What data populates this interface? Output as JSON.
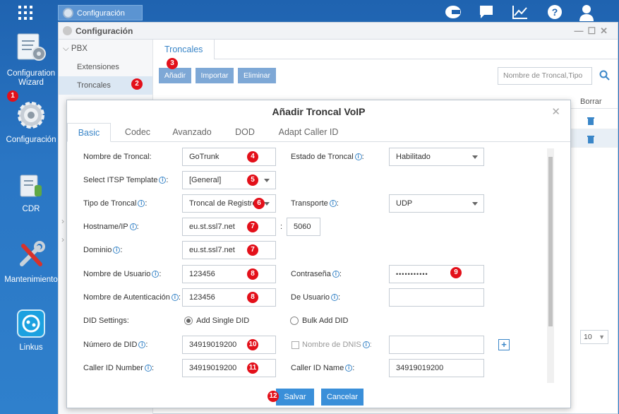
{
  "desktop": {
    "wizard_label": "Configuration Wizard",
    "config_label": "Configuración",
    "cdr_label": "CDR",
    "maint_label": "Mantenimiento",
    "linkus_label": "Linkus"
  },
  "taskbar": {
    "app_label": "Configuración"
  },
  "config_window": {
    "title": "Configuración",
    "nav": {
      "section": "PBX",
      "items": [
        "Extensiones",
        "Troncales"
      ]
    },
    "tab": "Troncales",
    "toolbar": {
      "add": "Añadir",
      "import": "Importar",
      "delete": "Eliminar"
    },
    "search_placeholder": "Nombre de Troncal,Tipo",
    "borrar_header": "Borrar",
    "page_size": "10"
  },
  "modal": {
    "title": "Añadir Troncal VoIP",
    "tabs": [
      "Basic",
      "Codec",
      "Avanzado",
      "DOD",
      "Adapt Caller ID"
    ],
    "labels": {
      "trunk_name": "Nombre de Troncal:",
      "trunk_status": "Estado de Troncal",
      "itsp": "Select ITSP Template",
      "trunk_type": "Tipo de Troncal",
      "transport": "Transporte",
      "hostname": "Hostname/IP",
      "domain": "Dominio",
      "username": "Nombre de Usuario",
      "password": "Contraseña",
      "auth_name": "Nombre de Autenticación",
      "from_user": "De Usuario",
      "did_settings": "DID Settings:",
      "add_single": "Add Single DID",
      "bulk_add": "Bulk Add DID",
      "did_number": "Número de DID",
      "dnis_name": "Nombre de DNIS",
      "caller_id_number": "Caller ID Number",
      "caller_id_name": "Caller ID Name"
    },
    "values": {
      "trunk_name": "GoTrunk",
      "trunk_status": "Habilitado",
      "itsp": "[General]",
      "trunk_type": "Troncal de Registro",
      "transport": "UDP",
      "hostname": "eu.st.ssl7.net",
      "port": "5060",
      "domain": "eu.st.ssl7.net",
      "username": "123456",
      "password": "•••••••••••",
      "auth_name": "123456",
      "from_user": "",
      "did_number": "34919019200",
      "dnis_name": "",
      "caller_id_number": "34919019200",
      "caller_id_name": "34919019200"
    },
    "buttons": {
      "save": "Salvar",
      "cancel": "Cancelar"
    },
    "colon": ":"
  },
  "badges": [
    "1",
    "2",
    "3",
    "4",
    "5",
    "6",
    "7",
    "7",
    "8",
    "8",
    "9",
    "10",
    "11",
    "12"
  ],
  "colors": {
    "accent": "#3a86c8",
    "badge": "#e3101a",
    "desktop_bg": "#2a76c4"
  }
}
